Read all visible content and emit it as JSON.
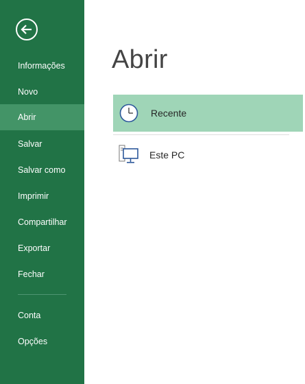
{
  "sidebar": {
    "back_icon": "back-arrow-icon",
    "items": [
      {
        "label": "Informações"
      },
      {
        "label": "Novo"
      },
      {
        "label": "Abrir",
        "active": true
      },
      {
        "label": "Salvar"
      },
      {
        "label": "Salvar como"
      },
      {
        "label": "Imprimir"
      },
      {
        "label": "Compartilhar"
      },
      {
        "label": "Exportar"
      },
      {
        "label": "Fechar"
      }
    ],
    "bottom_items": [
      {
        "label": "Conta"
      },
      {
        "label": "Opções"
      }
    ]
  },
  "main": {
    "title": "Abrir",
    "places": [
      {
        "label": "Recente",
        "icon": "clock-icon",
        "selected": true
      },
      {
        "label": "Este PC",
        "icon": "computer-icon",
        "selected": false
      }
    ]
  },
  "colors": {
    "sidebar_bg": "#217346",
    "sidebar_active": "#439467",
    "selected_place": "#9fd5b7",
    "title_text": "#444444",
    "icon_blue": "#2b579a"
  }
}
